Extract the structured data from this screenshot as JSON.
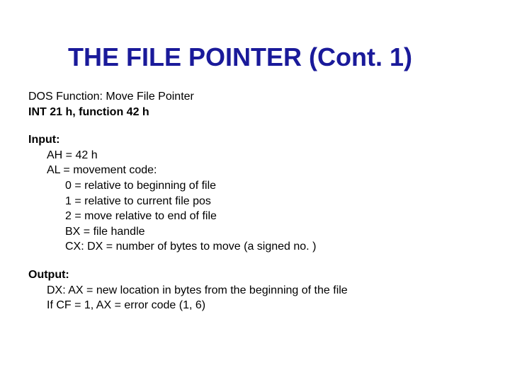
{
  "title": "THE FILE POINTER (Cont. 1)",
  "func_line": "DOS Function: Move File Pointer",
  "int_line": "INT 21 h, function 42 h",
  "input_label": "Input:",
  "input_ah": "AH = 42 h",
  "input_al": "AL = movement code:",
  "input_al_0": "0 = relative to beginning of file",
  "input_al_1": "1 = relative to current file pos",
  "input_al_2": "2 = move relative to end of file",
  "input_bx": "BX = file handle",
  "input_cxdx": "CX: DX = number of bytes to move (a signed no. )",
  "output_label": "Output:",
  "output_dxax": "DX: AX = new location in bytes from the beginning of the file",
  "output_cf": "If CF = 1, AX = error code (1, 6)"
}
